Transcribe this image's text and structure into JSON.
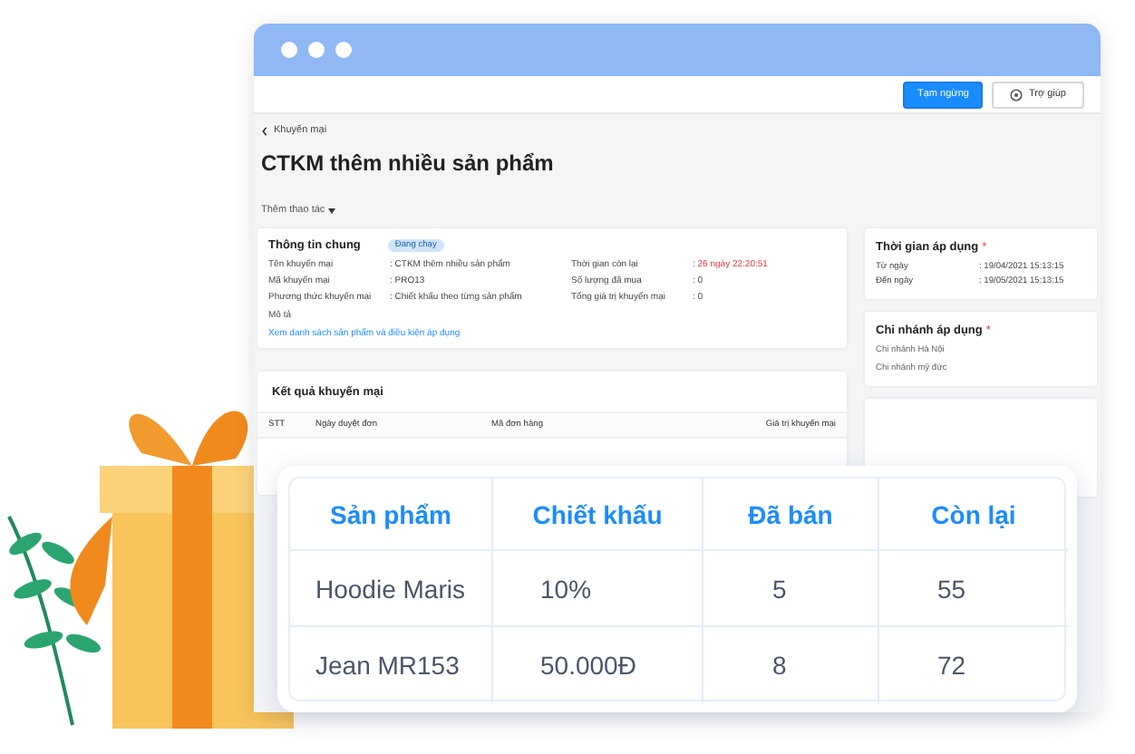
{
  "window": {
    "toolbar_buttons": [
      {
        "label": "Tạm ngừng",
        "kind": "primary"
      },
      {
        "label": "Trợ giúp",
        "kind": "help"
      }
    ],
    "breadcrumb": "Khuyến mại",
    "title": "CTKM thêm nhiều sản phẩm",
    "actions_menu": "Thêm thao tác",
    "general_info": {
      "title": "Thông tin chung",
      "status": "Đang chạy",
      "fields_left": [
        {
          "label": "Tên khuyến mại",
          "value": ": CTKM thêm nhiều sản phẩm",
          "alert": false
        },
        {
          "label": "Mã khuyến mại",
          "value": ": PRO13",
          "alert": false
        },
        {
          "label": "Phương thức khuyến mại",
          "value": ": Chiết khấu theo từng sản phẩm",
          "alert": false
        }
      ],
      "fields_right": [
        {
          "label": "Thời gian còn lại",
          "value": ": 26 ngày 22:20:51",
          "alert": true
        },
        {
          "label": "Số lượng đã mua",
          "value": ": 0",
          "alert": false
        },
        {
          "label": "Tổng giá trị khuyến mại",
          "value": ": 0",
          "alert": false
        }
      ],
      "description_label": "Mô tả",
      "link": "Xem danh sách sản phẩm và điều kiện áp dụng"
    },
    "results": {
      "title": "Kết quả khuyến mại",
      "columns": [
        "STT",
        "Ngày duyệt đơn",
        "Mã đơn hàng",
        "Giá trị khuyến mại"
      ]
    },
    "apply_time": {
      "title": "Thời gian áp dụng",
      "required_mark": "*",
      "rows": [
        {
          "label": "Từ ngày",
          "value": ": 19/04/2021 15:13:15"
        },
        {
          "label": "Đến ngày",
          "value": ": 19/05/2021 15:13:15"
        }
      ]
    },
    "branches": {
      "title": "Chi nhánh áp dụng",
      "required_mark": "*",
      "items": [
        "Chi nhánh Hà Nội",
        "Chi nhánh mỹ đức"
      ]
    }
  },
  "product_table": {
    "columns": [
      "Sản phẩm",
      "Chiết khấu",
      "Đã bán",
      "Còn lại"
    ],
    "rows": [
      [
        "Hoodie Maris",
        "10%",
        "5",
        "55"
      ],
      [
        "Jean MR153",
        "50.000Đ",
        "8",
        "72"
      ]
    ]
  }
}
